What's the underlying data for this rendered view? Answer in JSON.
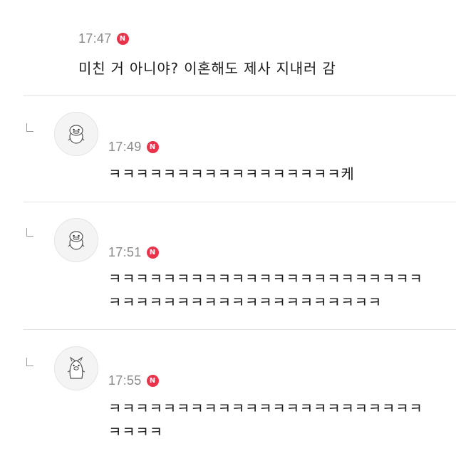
{
  "post": {
    "time": "17:47",
    "badge": "N",
    "text": "미친 거 아니야? 이혼해도 제사 지내러 감"
  },
  "replies": [
    {
      "time": "17:49",
      "badge": "N",
      "avatar_icon": "duck-character-icon",
      "lines": [
        "ㅋㅋㅋㅋㅋㅋㅋㅋㅋㅋㅋㅋㅋㅋㅋㅋㅋ케"
      ]
    },
    {
      "time": "17:51",
      "badge": "N",
      "avatar_icon": "duck-character-icon",
      "lines": [
        "ㅋㅋㅋㅋㅋㅋㅋㅋㅋㅋㅋㅋㅋㅋㅋㅋㅋㅋㅋㅋㅋㅋㅋ",
        "ㅋㅋㅋㅋㅋㅋㅋㅋㅋㅋㅋㅋㅋㅋㅋㅋㅋㅋㅋㅋ"
      ]
    },
    {
      "time": "17:55",
      "badge": "N",
      "avatar_icon": "pig-character-icon",
      "lines": [
        "ㅋㅋㅋㅋㅋㅋㅋㅋㅋㅋㅋㅋㅋㅋㅋㅋㅋㅋㅋㅋㅋㅋㅋ",
        "ㅋㅋㅋㅋ"
      ]
    }
  ],
  "colors": {
    "badge": "#e8334a",
    "divider": "#e3e3e3",
    "timestamp": "#8a8a8a"
  }
}
